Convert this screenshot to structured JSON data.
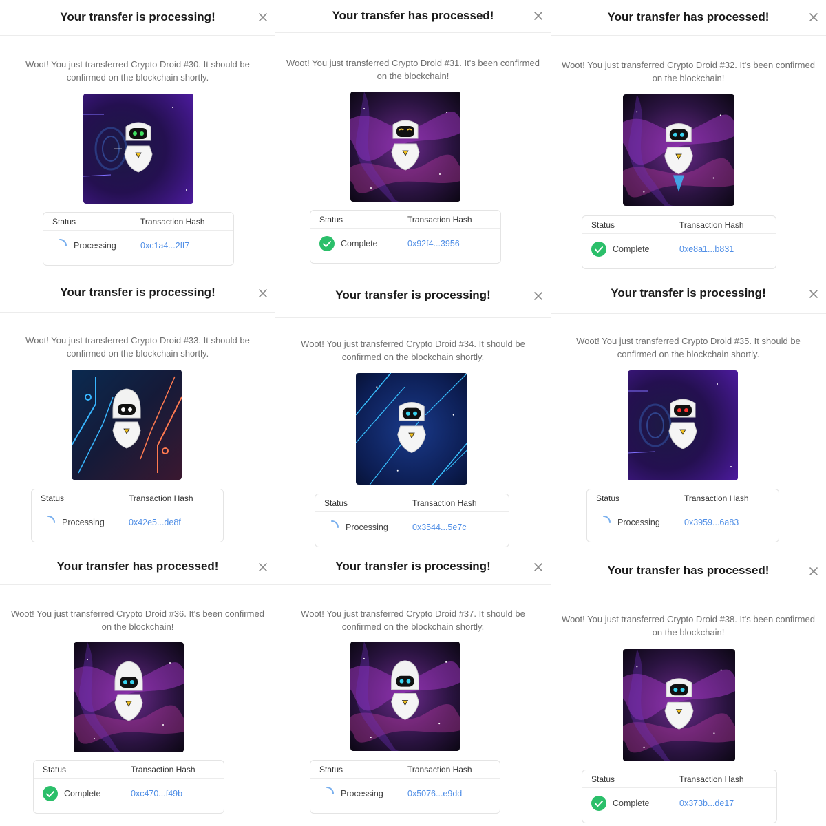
{
  "labels": {
    "status_header": "Status",
    "hash_header": "Transaction Hash"
  },
  "colors": {
    "complete": "#2bbf6a",
    "spinner": "#7ab0ee",
    "hash_link": "#4f8ee6",
    "title": "#1a1a1a"
  },
  "icons": {
    "close": "close-icon",
    "complete": "check-circle-icon",
    "processing": "spinner-icon"
  },
  "panels": [
    {
      "title": "Your transfer is processing!",
      "message": "Woot! You just transferred Crypto Droid #30. It should be confirmed on the blockchain shortly.",
      "status": "Processing",
      "hash": "0xc1a4...2ff7",
      "art": "artwork-crypto-droid-30"
    },
    {
      "title": "Your transfer has processed!",
      "message": "Woot! You just transferred Crypto Droid #31. It's been confirmed on the blockchain!",
      "status": "Complete",
      "hash": "0x92f4...3956",
      "art": "artwork-crypto-droid-31"
    },
    {
      "title": "Your transfer has processed!",
      "message": "Woot! You just transferred Crypto Droid #32. It's been confirmed on the blockchain!",
      "status": "Complete",
      "hash": "0xe8a1...b831",
      "art": "artwork-crypto-droid-32"
    },
    {
      "title": "Your transfer is processing!",
      "message": "Woot! You just transferred Crypto Droid #33. It should be confirmed on the blockchain shortly.",
      "status": "Processing",
      "hash": "0x42e5...de8f",
      "art": "artwork-crypto-droid-33"
    },
    {
      "title": "Your transfer is processing!",
      "message": "Woot! You just transferred Crypto Droid #34. It should be confirmed on the blockchain shortly.",
      "status": "Processing",
      "hash": "0x3544...5e7c",
      "art": "artwork-crypto-droid-34"
    },
    {
      "title": "Your transfer is processing!",
      "message": "Woot! You just transferred Crypto Droid #35. It should be confirmed on the blockchain shortly.",
      "status": "Processing",
      "hash": "0x3959...6a83",
      "art": "artwork-crypto-droid-35"
    },
    {
      "title": "Your transfer has processed!",
      "message": "Woot! You just transferred Crypto Droid #36. It's been confirmed on the blockchain!",
      "status": "Complete",
      "hash": "0xc470...f49b",
      "art": "artwork-crypto-droid-36"
    },
    {
      "title": "Your transfer is processing!",
      "message": "Woot! You just transferred Crypto Droid #37. It should be confirmed on the blockchain shortly.",
      "status": "Processing",
      "hash": "0x5076...e9dd",
      "art": "artwork-crypto-droid-37"
    },
    {
      "title": "Your transfer has processed!",
      "message": "Woot! You just transferred Crypto Droid #38. It's been confirmed on the blockchain!",
      "status": "Complete",
      "hash": "0x373b...de17",
      "art": "artwork-crypto-droid-38"
    }
  ]
}
